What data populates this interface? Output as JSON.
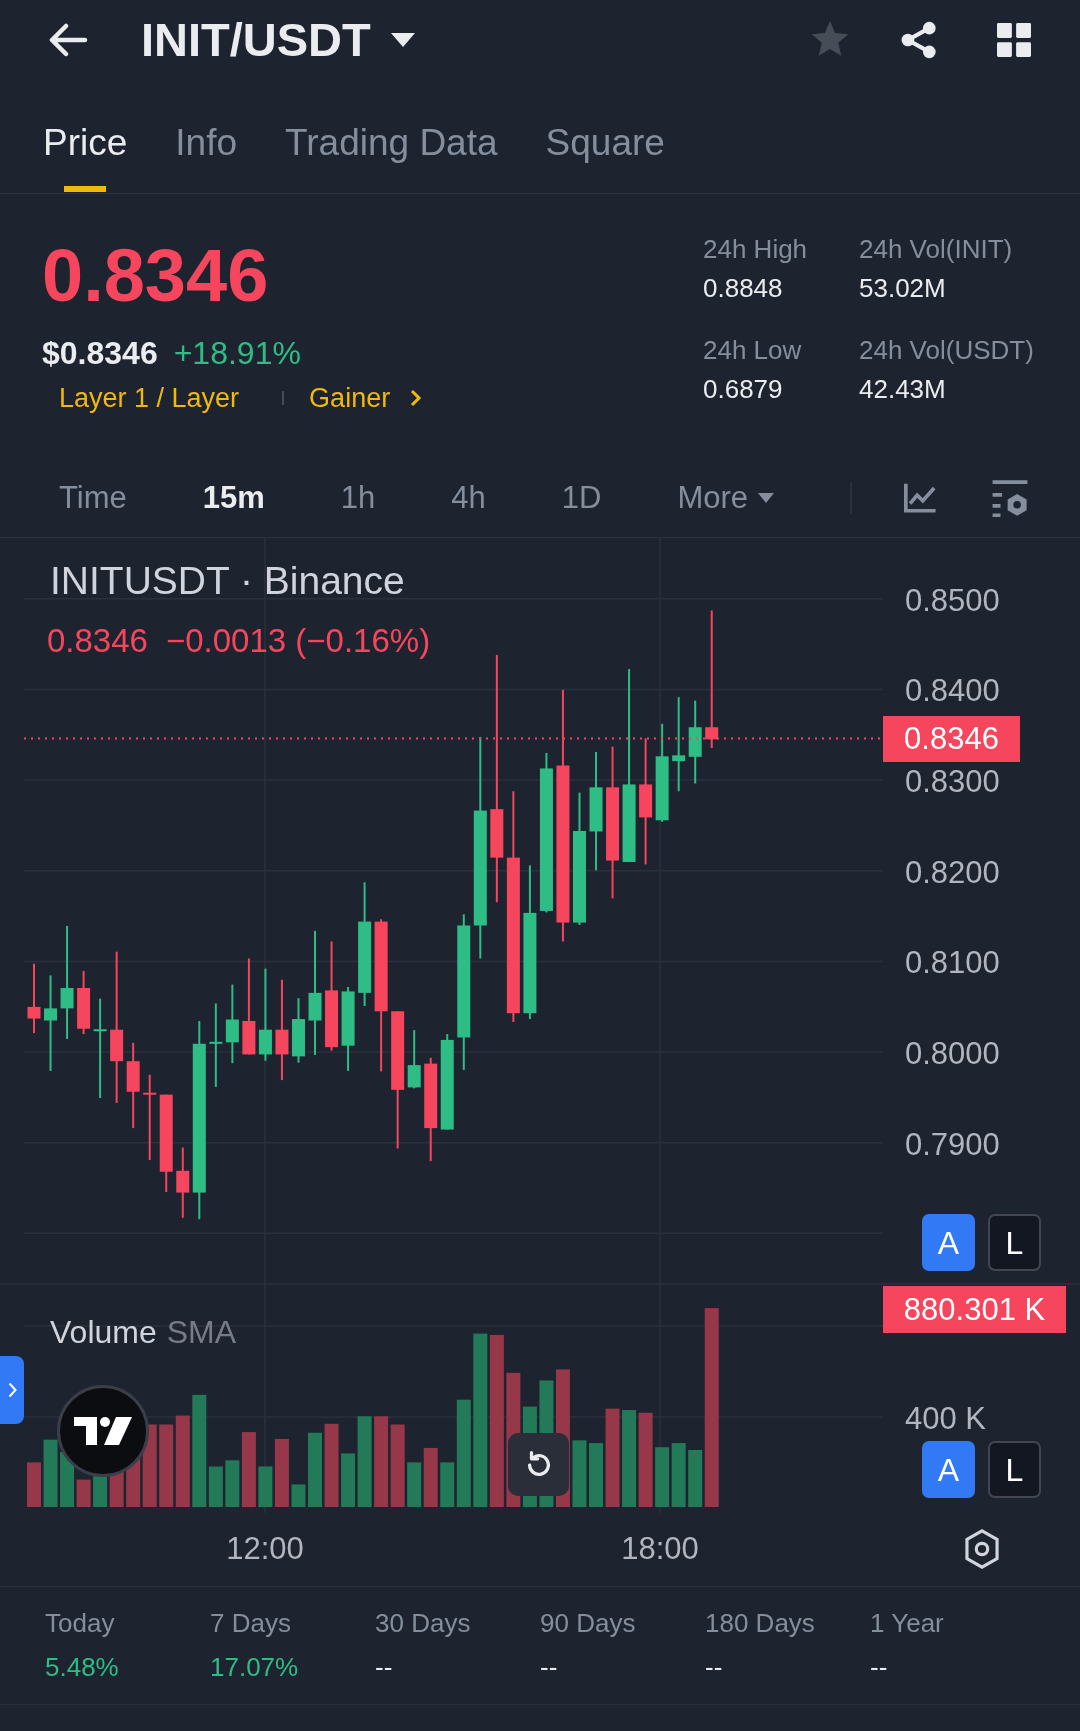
{
  "header": {
    "title": "INIT/USDT",
    "favorite": false
  },
  "tabs": [
    {
      "label": "Price",
      "selected": true
    },
    {
      "label": "Info",
      "selected": false
    },
    {
      "label": "Trading Data",
      "selected": false
    },
    {
      "label": "Square",
      "selected": false
    }
  ],
  "ticker": {
    "price": "0.8346",
    "price_falling": true,
    "fiat_price": "$0.8346",
    "change": "+18.91%",
    "change_rising": true,
    "tags": [
      "Layer 1 / Layer",
      "Gainer"
    ]
  },
  "stats": [
    {
      "label": "24h High",
      "value": "0.8848"
    },
    {
      "label": "24h Vol(INIT)",
      "value": "53.02M"
    },
    {
      "label": "24h Low",
      "value": "0.6879"
    },
    {
      "label": "24h Vol(USDT)",
      "value": "42.43M"
    }
  ],
  "intervals": [
    {
      "label": "Time",
      "kind": "interval",
      "selected": false
    },
    {
      "label": "15m",
      "kind": "interval",
      "selected": true
    },
    {
      "label": "1h",
      "kind": "interval",
      "selected": false
    },
    {
      "label": "4h",
      "kind": "interval",
      "selected": false
    },
    {
      "label": "1D",
      "kind": "interval",
      "selected": false
    },
    {
      "label": "More",
      "kind": "dropdown",
      "selected": false
    }
  ],
  "chart": {
    "symbol": "INITUSDT · Binance",
    "last": "0.8346",
    "change": "−0.0013 (−0.16%)",
    "falling": true,
    "price_axis": [
      "0.8500",
      "0.8400",
      "0.8300",
      "0.8200",
      "0.8100",
      "0.8000",
      "0.7900"
    ],
    "last_price_label": "0.8346",
    "scale_buttons": [
      {
        "label": "A",
        "on": true
      },
      {
        "label": "L",
        "on": false
      }
    ]
  },
  "volume": {
    "title": "Volume",
    "indicator": "SMA",
    "last_label": "880.301 K",
    "axis": [
      "400 K"
    ],
    "scale_buttons": [
      {
        "label": "A",
        "on": true
      },
      {
        "label": "L",
        "on": false
      }
    ]
  },
  "time_axis": [
    "12:00",
    "18:00"
  ],
  "performance": [
    {
      "label": "Today",
      "value": "5.48%",
      "rising": true
    },
    {
      "label": "7 Days",
      "value": "17.07%",
      "rising": true
    },
    {
      "label": "30 Days",
      "value": "--",
      "rising": false
    },
    {
      "label": "90 Days",
      "value": "--",
      "rising": false
    },
    {
      "label": "180 Days",
      "value": "--",
      "rising": false
    },
    {
      "label": "1 Year",
      "value": "--",
      "rising": false
    }
  ]
}
